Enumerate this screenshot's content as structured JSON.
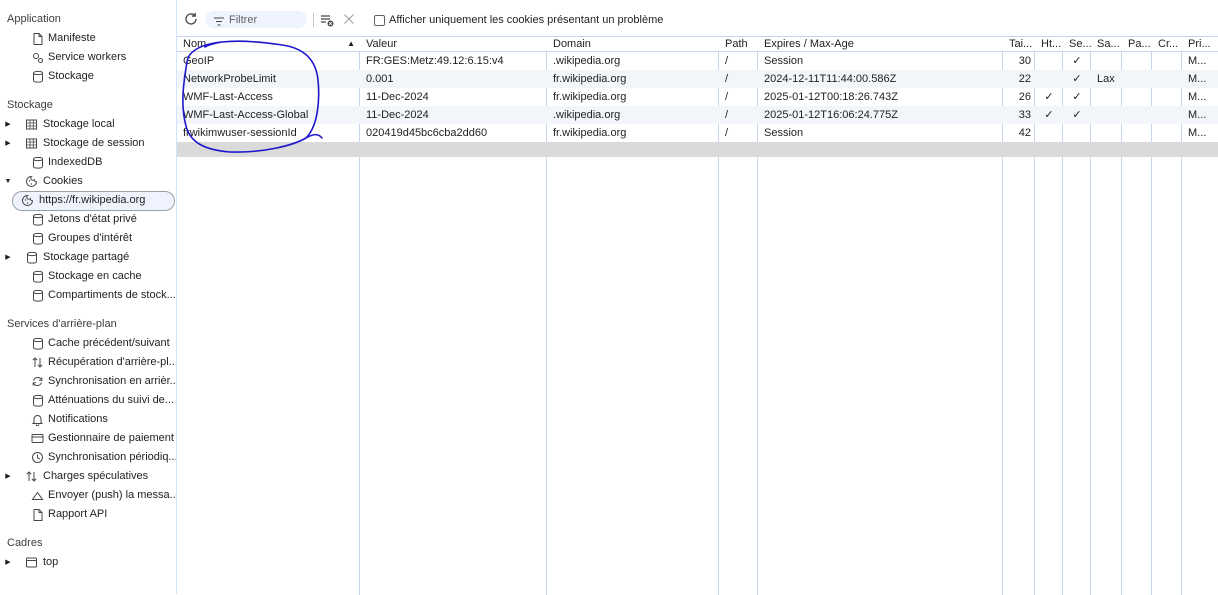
{
  "sidebar": {
    "application": {
      "heading": "Application",
      "items": [
        {
          "label": "Manifeste",
          "icon": "document-icon"
        },
        {
          "label": "Service workers",
          "icon": "gears-icon"
        },
        {
          "label": "Stockage",
          "icon": "database-icon"
        }
      ]
    },
    "storage": {
      "heading": "Stockage",
      "items": [
        {
          "label": "Stockage local",
          "icon": "table-icon",
          "expandable": true
        },
        {
          "label": "Stockage de session",
          "icon": "table-icon",
          "expandable": true
        },
        {
          "label": "IndexedDB",
          "icon": "database-icon"
        },
        {
          "label": "Cookies",
          "icon": "cookie-icon",
          "expanded": true
        },
        {
          "label": "https://fr.wikipedia.org",
          "icon": "cookie-icon",
          "selected": true
        },
        {
          "label": "Jetons d'état privé",
          "icon": "database-icon"
        },
        {
          "label": "Groupes d'intérêt",
          "icon": "database-icon"
        },
        {
          "label": "Stockage partagé",
          "icon": "database-icon",
          "expandable": true
        },
        {
          "label": "Stockage en cache",
          "icon": "database-icon"
        },
        {
          "label": "Compartiments de stock...",
          "icon": "database-icon"
        }
      ]
    },
    "background": {
      "heading": "Services d'arrière-plan",
      "items": [
        {
          "label": "Cache précédent/suivant",
          "icon": "database-icon"
        },
        {
          "label": "Récupération d'arrière-pl...",
          "icon": "up-down-arrows-icon"
        },
        {
          "label": "Synchronisation en arrièr...",
          "icon": "sync-icon"
        },
        {
          "label": "Atténuations du suivi de...",
          "icon": "database-icon"
        },
        {
          "label": "Notifications",
          "icon": "bell-icon"
        },
        {
          "label": "Gestionnaire de paiement",
          "icon": "card-icon"
        },
        {
          "label": "Synchronisation périodiq...",
          "icon": "clock-icon"
        },
        {
          "label": "Charges spéculatives",
          "icon": "up-down-arrows-icon",
          "expandable": true
        },
        {
          "label": "Envoyer (push) la messa...",
          "icon": "cloud-icon"
        },
        {
          "label": "Rapport API",
          "icon": "document-icon"
        }
      ]
    },
    "frames": {
      "heading": "Cadres",
      "items": [
        {
          "label": "top",
          "icon": "frame-icon",
          "expandable": true
        }
      ]
    }
  },
  "toolbar": {
    "refresh_icon": "refresh-icon",
    "filter_placeholder": "Filtrer",
    "clear_all_icon": "clear-filtered-icon",
    "delete_icon": "close-icon",
    "only_issues_label": "Afficher uniquement les cookies présentant un problème",
    "only_issues_checked": false
  },
  "table": {
    "columns": [
      {
        "key": "name",
        "label": "Nom",
        "sorted": "ascending"
      },
      {
        "key": "value",
        "label": "Valeur"
      },
      {
        "key": "domain",
        "label": "Domain"
      },
      {
        "key": "path",
        "label": "Path"
      },
      {
        "key": "expires",
        "label": "Expires / Max-Age"
      },
      {
        "key": "size",
        "label": "Tai..."
      },
      {
        "key": "httponly",
        "label": "Ht..."
      },
      {
        "key": "secure",
        "label": "Se..."
      },
      {
        "key": "samesite",
        "label": "Sa..."
      },
      {
        "key": "partition",
        "label": "Pa..."
      },
      {
        "key": "crosssite",
        "label": "Cr..."
      },
      {
        "key": "priority",
        "label": "Pri..."
      }
    ],
    "sort_indicator": "▲",
    "rows": [
      {
        "name": "GeoIP",
        "value": "FR:GES:Metz:49.12:6.15:v4",
        "domain": ".wikipedia.org",
        "path": "/",
        "expires": "Session",
        "size": "30",
        "httponly": "",
        "secure": "✓",
        "samesite": "",
        "partition": "",
        "crosssite": "",
        "priority": "M..."
      },
      {
        "name": "NetworkProbeLimit",
        "value": "0.001",
        "domain": "fr.wikipedia.org",
        "path": "/",
        "expires": "2024-12-11T11:44:00.586Z",
        "size": "22",
        "httponly": "",
        "secure": "✓",
        "samesite": "Lax",
        "partition": "",
        "crosssite": "",
        "priority": "M..."
      },
      {
        "name": "WMF-Last-Access",
        "value": "11-Dec-2024",
        "domain": "fr.wikipedia.org",
        "path": "/",
        "expires": "2025-01-12T00:18:26.743Z",
        "size": "26",
        "httponly": "✓",
        "secure": "✓",
        "samesite": "",
        "partition": "",
        "crosssite": "",
        "priority": "M..."
      },
      {
        "name": "WMF-Last-Access-Global",
        "value": "11-Dec-2024",
        "domain": ".wikipedia.org",
        "path": "/",
        "expires": "2025-01-12T16:06:24.775Z",
        "size": "33",
        "httponly": "✓",
        "secure": "✓",
        "samesite": "",
        "partition": "",
        "crosssite": "",
        "priority": "M..."
      },
      {
        "name": "frwikimwuser-sessionId",
        "value": "020419d45bc6cba2dd60",
        "domain": "fr.wikipedia.org",
        "path": "/",
        "expires": "Session",
        "size": "42",
        "httponly": "",
        "secure": "",
        "samesite": "",
        "partition": "",
        "crosssite": "",
        "priority": "M..."
      }
    ]
  },
  "colors": {
    "accent": "#1a73e8",
    "annotation_ink": "#1d17c9",
    "selected_row_fill": "#dadada",
    "grid_line": "#c7d5ea"
  }
}
